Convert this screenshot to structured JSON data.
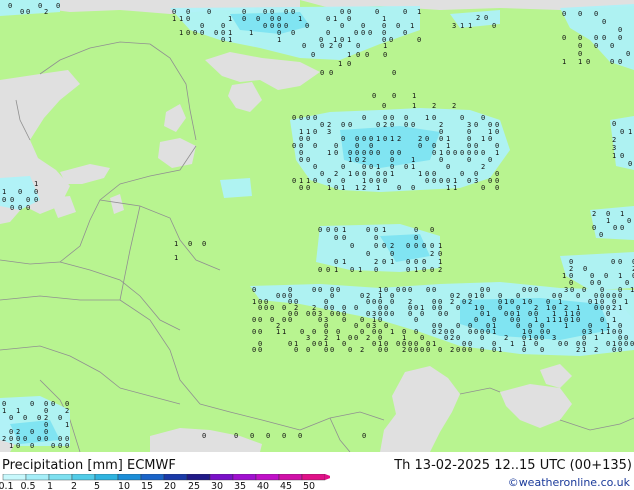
{
  "map": {
    "colors": {
      "sea": "#e0e0e0",
      "land": "#b8f490",
      "borders": "#909090",
      "precip_light": "#aef2f8",
      "precip_mid": "#80e4f2"
    },
    "markers": [
      "0",
      "1",
      "2",
      "3"
    ]
  },
  "footer": {
    "title_left": "Precipitation [mm]  ECMWF",
    "title_right": "Th 13-02-2025 12..15 UTC (00+135)",
    "credit": "©weatheronline.co.uk",
    "scale": {
      "labels": [
        "0.1",
        "0.5",
        "1",
        "2",
        "5",
        "10",
        "15",
        "20",
        "25",
        "30",
        "35",
        "40",
        "45",
        "50"
      ],
      "colors": [
        "#c8f8fc",
        "#a6eef8",
        "#7ee0f0",
        "#52cce8",
        "#30b4e0",
        "#1c8ed8",
        "#1a64c8",
        "#1a3aa8",
        "#201a88",
        "#7a10c8",
        "#a010d0",
        "#c010c8",
        "#d010a8",
        "#e01088"
      ]
    }
  }
}
